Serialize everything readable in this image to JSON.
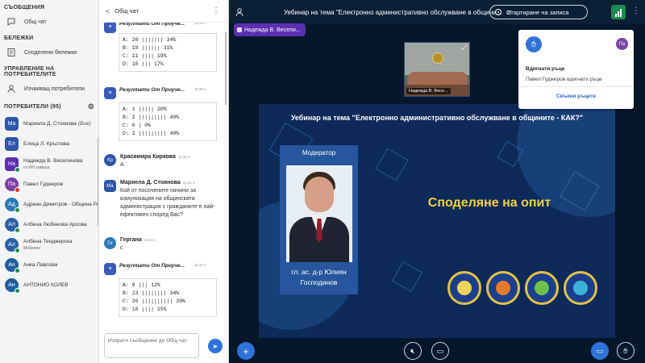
{
  "sidebar": {
    "messages_heading": "СЪОБЩЕНИЯ",
    "public_chat": "Общ чат",
    "notes_heading": "БЕЛЕЖКИ",
    "shared_notes": "Споделени бележки",
    "user_mgmt_heading": "УПРАВЛЕНИЕ НА ПОТРЕБИТЕЛИТЕ",
    "clear_users": "Изчакващ потребители",
    "users_heading": "ПОТРЕБИТЕЛИ",
    "users_count": "(95)",
    "users": [
      {
        "initials": "Ма",
        "name": "Мариела Д. Стоянова",
        "suffix": "(Вие)",
        "sub": "",
        "color": "#2e55a8",
        "round": false,
        "dot": ""
      },
      {
        "initials": "Ел",
        "name": "Елица Л. Кръстева",
        "suffix": "",
        "sub": "",
        "color": "#2e55a8",
        "round": false,
        "dot": ""
      },
      {
        "initials": "На",
        "name": "Надежда В. Веселинова",
        "suffix": "",
        "sub": "ск Ф/б камера",
        "color": "#5a2fb0",
        "round": false,
        "dot": "green"
      },
      {
        "initials": "Па",
        "name": "Павел Гуджеров",
        "suffix": "",
        "sub": "",
        "color": "#7b3fa8",
        "round": true,
        "dot": "red"
      },
      {
        "initials": "Ад",
        "name": "Адриан Димитров - Община Ра...",
        "suffix": "",
        "sub": "",
        "color": "#2a7ab8",
        "round": true,
        "dot": "green"
      },
      {
        "initials": "Ал",
        "name": "Албена Любенова Арсова",
        "suffix": "",
        "sub": "",
        "color": "#2a5fa8",
        "round": true,
        "dot": "green"
      },
      {
        "initials": "Ал",
        "name": "Албена Тенджерска",
        "suffix": "",
        "sub": "Мобилен",
        "color": "#2a5fa8",
        "round": true,
        "dot": "green"
      },
      {
        "initials": "Ан",
        "name": "Анка Павлова",
        "suffix": "",
        "sub": "",
        "color": "#1f5fa0",
        "round": true,
        "dot": "green"
      },
      {
        "initials": "Ан",
        "name": "АНТОНИО КОЛЕВ",
        "suffix": "",
        "sub": "",
        "color": "#1f5fa0",
        "round": true,
        "dot": "green"
      }
    ]
  },
  "chat": {
    "title": "Общ чат",
    "input_placeholder": "Изпрати съобщение до Общ чат",
    "poll1": {
      "lines": [
        "A: 20 ||||||| 34%",
        "B: 18 |||||| 31%",
        "C: 11 |||| 19%",
        "D: 10 ||| 17%"
      ]
    },
    "poll2": {
      "title": "Резултати От Проуче...",
      "time": "11:29 ч.",
      "lines": [
        "A: 1 ||||| 20%",
        "B: 2 ||||||||| 40%",
        "C: 0 | 0%",
        "D: 2 ||||||||| 40%"
      ]
    },
    "msg1": {
      "initials": "Кр",
      "who": "Красимира Киркова",
      "time": "11:30 ч.",
      "text": "А"
    },
    "msg2": {
      "initials": "Ма",
      "who": "Мариела Д. Стоянова",
      "time": "11:31 ч.",
      "text": "Кой от посочените начини за комуникация на общинската администрация с гражданите е най-ефективен според Вас?"
    },
    "msg3": {
      "initials": "Ге",
      "who": "Гергана",
      "time": "11:32 ч.",
      "text": "с"
    },
    "poll3": {
      "title": "Резултати От Проуче...",
      "time": "11:32 ч.",
      "lines": [
        "A: 8 ||| 12%",
        "B: 23 |||||||| 34%",
        "C: 26 |||||||||| 39%",
        "D: 10 |||| 15%"
      ]
    }
  },
  "topbar": {
    "title": "Уебинар на тема \"Електронно административно обслужване в общини...",
    "record_label": "Стартиране на записа"
  },
  "presenter": {
    "name": "Надежда В. Весели..."
  },
  "webcam": {
    "label": "Надежда В. Весе..."
  },
  "raised_hands": {
    "initials": "Па",
    "title": "Вдигнати ръце",
    "desc": "Павел Гуджеров вдигнати ръце",
    "lower_label": "Свъкни ръцете"
  },
  "slide": {
    "title": "Уебинар на тема \"Електронно административно обслужване в общините - КАК?\"",
    "moderator_label": "Модератор",
    "moderator_name_line1": "гл. ас. д-р Юлиян",
    "moderator_name_line2": "Господинов",
    "subtitle": "Споделяне на опит"
  },
  "colors": {
    "accent": "#2f73d9",
    "dark_bg": "#06172b",
    "slide_bg": "#0d2a59",
    "subtitle": "#f5d13b"
  }
}
